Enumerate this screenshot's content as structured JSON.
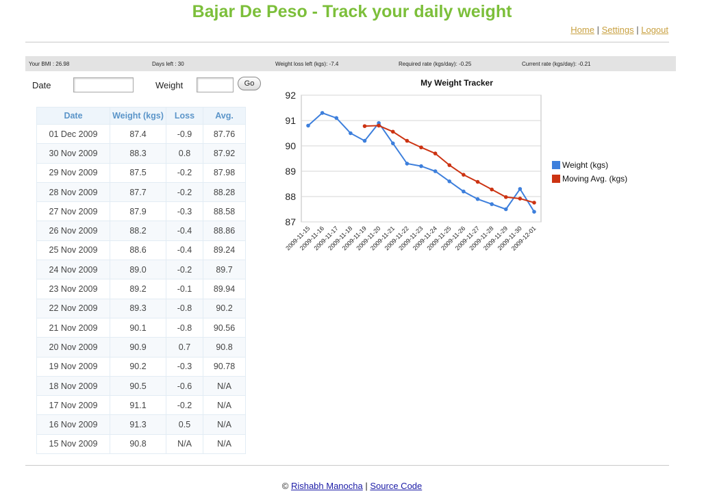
{
  "header": {
    "title": "Bajar De Peso - Track your daily weight",
    "nav": [
      {
        "label": "Home"
      },
      {
        "label": "Settings"
      },
      {
        "label": "Logout"
      }
    ],
    "separator": "|"
  },
  "stats": {
    "bmi": "Your BMI : 26.98",
    "days_left": "Days left : 30",
    "weight_loss_left": "Weight loss left (kgs): -7.4",
    "required_rate": "Required rate (kgs/day): -0.25",
    "current_rate": "Current rate (kgs/day): -0.21"
  },
  "form": {
    "date_label": "Date",
    "date_value": "",
    "weight_label": "Weight",
    "weight_value": "",
    "go_label": "Go"
  },
  "table": {
    "headers": [
      "Date",
      "Weight (kgs)",
      "Loss",
      "Avg."
    ],
    "rows": [
      [
        "01 Dec 2009",
        "87.4",
        "-0.9",
        "87.76"
      ],
      [
        "30 Nov 2009",
        "88.3",
        "0.8",
        "87.92"
      ],
      [
        "29 Nov 2009",
        "87.5",
        "-0.2",
        "87.98"
      ],
      [
        "28 Nov 2009",
        "87.7",
        "-0.2",
        "88.28"
      ],
      [
        "27 Nov 2009",
        "87.9",
        "-0.3",
        "88.58"
      ],
      [
        "26 Nov 2009",
        "88.2",
        "-0.4",
        "88.86"
      ],
      [
        "25 Nov 2009",
        "88.6",
        "-0.4",
        "89.24"
      ],
      [
        "24 Nov 2009",
        "89.0",
        "-0.2",
        "89.7"
      ],
      [
        "23 Nov 2009",
        "89.2",
        "-0.1",
        "89.94"
      ],
      [
        "22 Nov 2009",
        "89.3",
        "-0.8",
        "90.2"
      ],
      [
        "21 Nov 2009",
        "90.1",
        "-0.8",
        "90.56"
      ],
      [
        "20 Nov 2009",
        "90.9",
        "0.7",
        "90.8"
      ],
      [
        "19 Nov 2009",
        "90.2",
        "-0.3",
        "90.78"
      ],
      [
        "18 Nov 2009",
        "90.5",
        "-0.6",
        "N/A"
      ],
      [
        "17 Nov 2009",
        "91.1",
        "-0.2",
        "N/A"
      ],
      [
        "16 Nov 2009",
        "91.3",
        "0.5",
        "N/A"
      ],
      [
        "15 Nov 2009",
        "90.8",
        "N/A",
        "N/A"
      ]
    ]
  },
  "chart_data": {
    "type": "line",
    "title": "My Weight Tracker",
    "xlabel": "",
    "ylabel": "",
    "ylim": [
      87,
      92
    ],
    "yticks": [
      87,
      88,
      89,
      90,
      91,
      92
    ],
    "grid": true,
    "legend_position": "right",
    "x": [
      "2009-11-15",
      "2009-11-16",
      "2009-11-17",
      "2009-11-18",
      "2009-11-19",
      "2009-11-20",
      "2009-11-21",
      "2009-11-22",
      "2009-11-23",
      "2009-11-24",
      "2009-11-25",
      "2009-11-26",
      "2009-11-27",
      "2009-11-28",
      "2009-11-29",
      "2009-11-30",
      "2009-12-01"
    ],
    "series": [
      {
        "name": "Weight (kgs)",
        "color": "#3d7fdc",
        "values": [
          90.8,
          91.3,
          91.1,
          90.5,
          90.2,
          90.9,
          90.1,
          89.3,
          89.2,
          89.0,
          88.6,
          88.2,
          87.9,
          87.7,
          87.5,
          88.3,
          87.4
        ]
      },
      {
        "name": "Moving Avg. (kgs)",
        "color": "#cc3312",
        "values": [
          null,
          null,
          null,
          null,
          90.78,
          90.8,
          90.56,
          90.2,
          89.94,
          89.7,
          89.24,
          88.86,
          88.58,
          88.28,
          87.98,
          87.92,
          87.76
        ]
      }
    ]
  },
  "footer": {
    "copyright": "©",
    "author_link": "Rishabh Manocha",
    "separator": "|",
    "source_link": "Source Code"
  }
}
